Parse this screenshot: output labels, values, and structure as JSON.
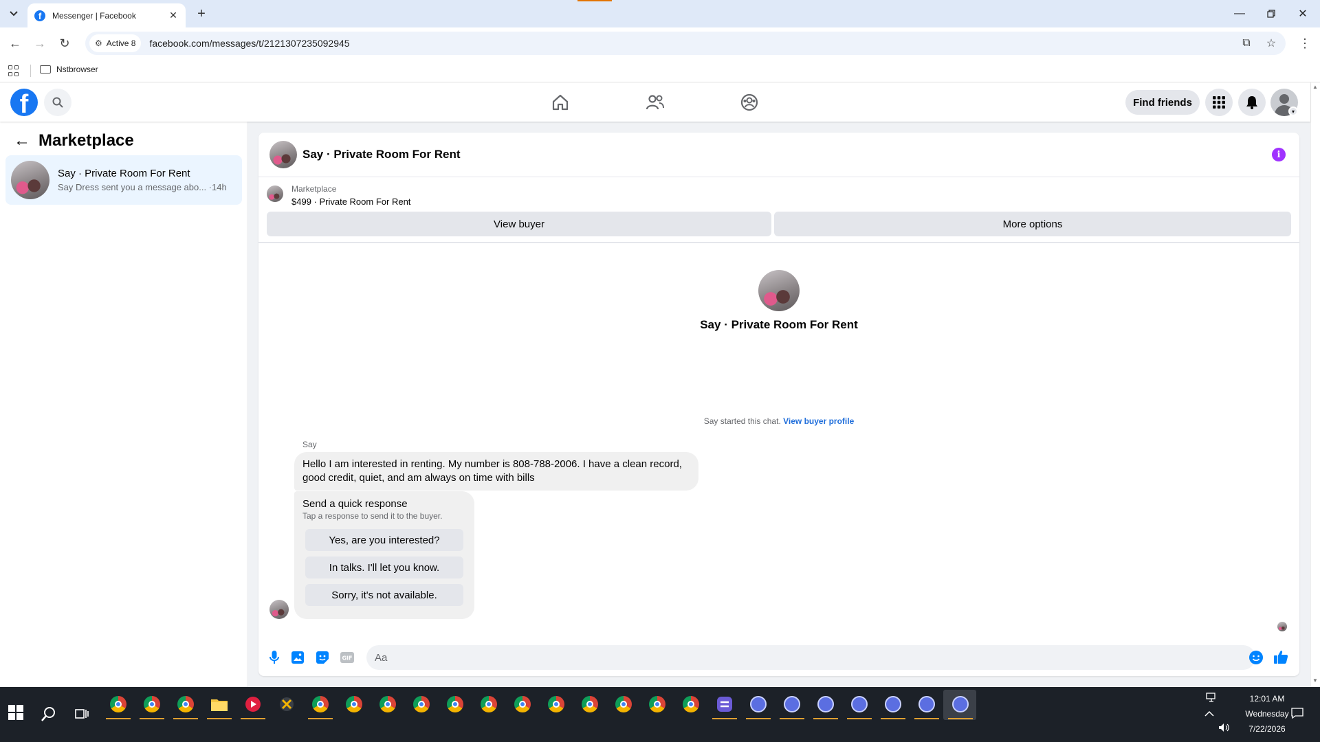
{
  "browser": {
    "tab_title": "Messenger | Facebook",
    "site_chip": "Active 8",
    "url": "facebook.com/messages/t/2121307235092945",
    "bookmark_folder": "Nstbrowser"
  },
  "header": {
    "find_friends": "Find friends"
  },
  "sidebar": {
    "title": "Marketplace",
    "conversation": {
      "name": "Say · Private Room For Rent",
      "preview": "Say Dress sent you a message abo... ·14h"
    }
  },
  "chat": {
    "title": "Say · Private Room For Rent",
    "listing_label": "Marketplace",
    "listing_title": "$499 · Private Room For Rent",
    "view_buyer": "View buyer",
    "more_options": "More options",
    "intro_name": "Say · Private Room For Rent",
    "started_text": "Say started this chat.",
    "view_buyer_profile": "View buyer profile",
    "sender": "Say",
    "message": "Hello I am interested in renting. My number is 808-788-2006. I have a clean record, good credit, quiet, and am always on time with bills",
    "quick_title": "Send a quick response",
    "quick_sub": "Tap a response to send it to the buyer.",
    "quick_responses": [
      "Yes, are you interested?",
      "In talks. I'll let you know.",
      "Sorry, it's not available."
    ],
    "input_placeholder": "Aa"
  },
  "taskbar": {
    "time": "12:01 AM",
    "day": "Wednesday",
    "date": "7/22/2026"
  },
  "colors": {
    "fb_blue": "#1877f2",
    "messenger_blue": "#0084ff",
    "info_purple": "#a033ff",
    "selected_row": "#ebf5ff"
  }
}
